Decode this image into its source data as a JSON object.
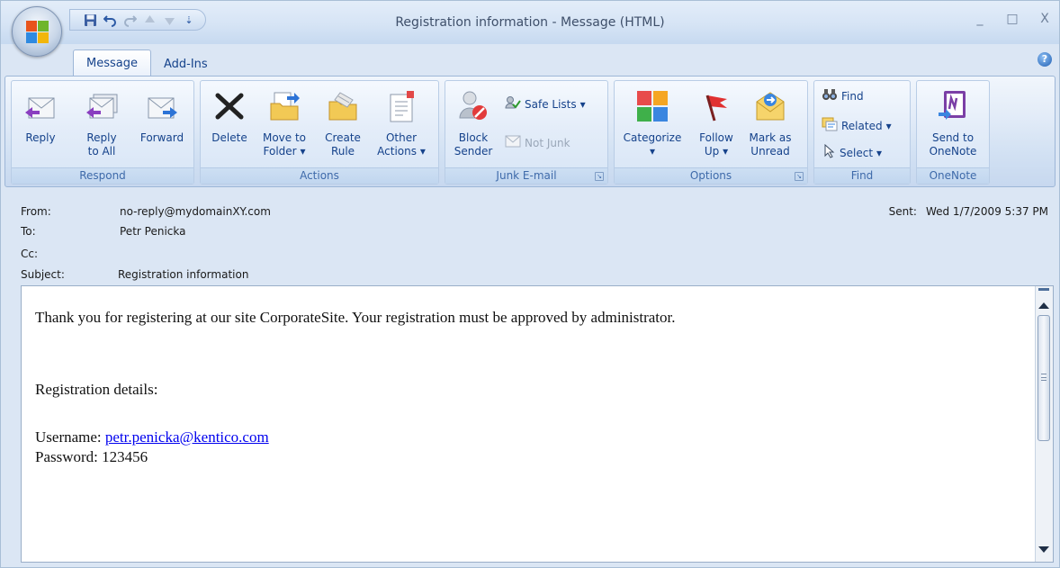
{
  "window": {
    "title": "Registration information - Message (HTML)",
    "minimize": "_",
    "maximize": "□",
    "close": "X"
  },
  "quick_access": {
    "icons": [
      "save-icon",
      "undo-icon",
      "redo-icon",
      "previous-item-icon",
      "next-item-icon",
      "customize-dropdown-icon"
    ],
    "customize": "⇣"
  },
  "tabs": [
    {
      "label": "Message",
      "active": true
    },
    {
      "label": "Add-Ins",
      "active": false
    }
  ],
  "help": "?",
  "ribbon": {
    "groups": {
      "respond": {
        "label": "Respond",
        "buttons": [
          {
            "label": "Reply",
            "icon": "reply-icon"
          },
          {
            "label": "Reply to All",
            "line1": "Reply",
            "line2": "to All",
            "icon": "reply-all-icon"
          },
          {
            "label": "Forward",
            "icon": "forward-icon"
          }
        ]
      },
      "actions": {
        "label": "Actions",
        "buttons": [
          {
            "line1": "Delete",
            "icon": "delete-icon"
          },
          {
            "line1": "Move to",
            "line2": "Folder",
            "icon": "move-to-folder-icon"
          },
          {
            "line1": "Create",
            "line2": "Rule",
            "icon": "create-rule-icon"
          },
          {
            "line1": "Other",
            "line2": "Actions",
            "icon": "other-actions-icon"
          }
        ]
      },
      "junk": {
        "label": "Junk E-mail",
        "block_line1": "Block",
        "block_line2": "Sender",
        "safe_lists": "Safe Lists",
        "not_junk": "Not Junk"
      },
      "options": {
        "label": "Options",
        "buttons": [
          {
            "line1": "Categorize",
            "icon": "categorize-icon"
          },
          {
            "line1": "Follow",
            "line2": "Up",
            "icon": "follow-up-flag-icon"
          },
          {
            "line1": "Mark as",
            "line2": "Unread",
            "icon": "mark-as-unread-icon"
          }
        ]
      },
      "find": {
        "label": "Find",
        "find": "Find",
        "related": "Related",
        "select": "Select"
      },
      "onenote": {
        "label": "OneNote",
        "line1": "Send to",
        "line2": "OneNote"
      }
    },
    "dropdown_arrow": "▾"
  },
  "header": {
    "from_label": "From:",
    "from_value": "no-reply@mydomainXY.com",
    "to_label": "To:",
    "to_value": "Petr Penicka",
    "cc_label": "Cc:",
    "cc_value": "",
    "subject_label": "Subject:",
    "subject_value": "Registration information",
    "sent_label": "Sent:",
    "sent_value": "Wed 1/7/2009 5:37 PM"
  },
  "body": {
    "intro": "Thank you for registering at our site CorporateSite. Your registration must be approved by administrator.",
    "details_heading": "Registration details:",
    "username_label": "Username: ",
    "username_value": "petr.penicka@kentico.com",
    "password_label": "Password: ",
    "password_value": "123456"
  },
  "colors": {
    "ribbon_text": "#15428b",
    "link": "#0000ee",
    "window_bg": "#dbe6f4"
  }
}
